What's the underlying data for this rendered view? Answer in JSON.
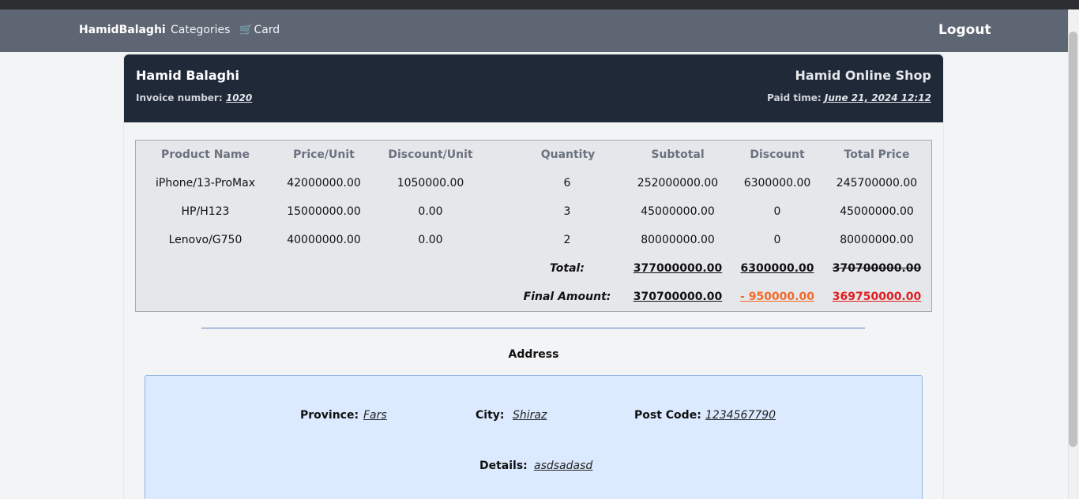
{
  "nav": {
    "brand": "HamidBalaghi",
    "categories": "Categories",
    "card_icon": "🛒",
    "card": "Card",
    "logout": "Logout"
  },
  "invoice": {
    "customer_name": "Hamid Balaghi",
    "shop_name": "Hamid Online Shop",
    "invoice_label": "Invoice number:",
    "invoice_number": "1020",
    "paid_label": "Paid time:",
    "paid_time": "June 21, 2024 12:12"
  },
  "table": {
    "headers": [
      "Product Name",
      "Price/Unit",
      "Discount/Unit",
      "Quantity",
      "Subtotal",
      "Discount",
      "Total Price"
    ],
    "rows": [
      [
        "iPhone/13-ProMax",
        "42000000.00",
        "1050000.00",
        "6",
        "252000000.00",
        "6300000.00",
        "245700000.00"
      ],
      [
        "HP/H123",
        "15000000.00",
        "0.00",
        "3",
        "45000000.00",
        "0",
        "45000000.00"
      ],
      [
        "Lenovo/G750",
        "40000000.00",
        "0.00",
        "2",
        "80000000.00",
        "0",
        "80000000.00"
      ]
    ],
    "total": {
      "label": "Total:",
      "subtotal": "377000000.00",
      "discount": "6300000.00",
      "total_price": "370700000.00"
    },
    "final": {
      "label": "Final Amount:",
      "subtotal": "370700000.00",
      "discount": "- 950000.00",
      "total_price": "369750000.00"
    }
  },
  "address": {
    "title": "Address",
    "province_label": "Province:",
    "province": "Fars",
    "city_label": "City:",
    "city": "Shiraz",
    "postcode_label": "Post Code:",
    "postcode": "1234567790",
    "details_label": "Details:",
    "details": "asdsadasd"
  },
  "colors": {
    "navbar": "#5f6673",
    "header": "#1f2937",
    "table_bg": "#e5e7eb",
    "address_bg": "#dbeafe",
    "discount_orange": "#f26b2a",
    "final_red": "#e11d1d"
  }
}
